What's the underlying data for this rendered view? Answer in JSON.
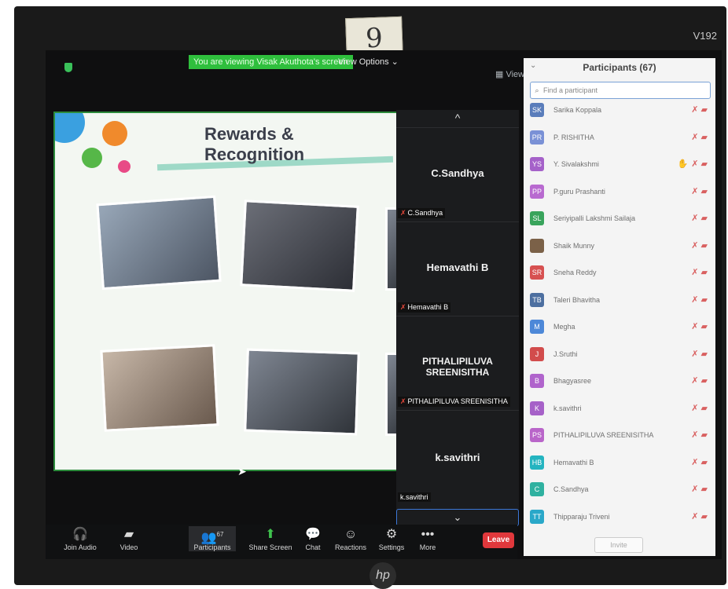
{
  "bezel": {
    "model_label": "V192",
    "sticky_note": "9",
    "brand_logo": "hp"
  },
  "zoom_top": {
    "viewing_banner": "You are viewing Visak Akuthota's screen",
    "view_options": "View Options ⌄",
    "view_button": "View"
  },
  "slide": {
    "title": "Rewards & Recognition"
  },
  "gallery": {
    "up_chevron": "^",
    "down_chevron": "⌄",
    "tiles": [
      {
        "name": "C.Sandhya",
        "label": "C.Sandhya"
      },
      {
        "name": "Hemavathi B",
        "label": "Hemavathi B"
      },
      {
        "name": "PITHALIPILUVA SREENISITHA",
        "label": "PITHALIPILUVA SREENISITHA"
      },
      {
        "name": "k.savithri",
        "label": "k.savithri"
      }
    ]
  },
  "participants_panel": {
    "title": "Participants (67)",
    "search_placeholder": "Find a participant",
    "invite_label": "Invite",
    "participants": [
      {
        "initials": "SK",
        "name": "Sarika Koppala",
        "color": "#5a7dbb",
        "raised_hand": false
      },
      {
        "initials": "PR",
        "name": "P. RISHITHA",
        "color": "#7a91d6",
        "raised_hand": false
      },
      {
        "initials": "YS",
        "name": "Y. Sivalakshmi",
        "color": "#a561c9",
        "raised_hand": true
      },
      {
        "initials": "PP",
        "name": "P.guru Prashanti",
        "color": "#b86ad0",
        "raised_hand": false
      },
      {
        "initials": "SL",
        "name": "Seriyipalli Lakshmi Sailaja",
        "color": "#39a45c",
        "raised_hand": false
      },
      {
        "initials": "",
        "name": "Shaik Munny",
        "color": "#7b6148",
        "raised_hand": false
      },
      {
        "initials": "SR",
        "name": "Sneha Reddy",
        "color": "#d75151",
        "raised_hand": false
      },
      {
        "initials": "TB",
        "name": "Taleri Bhavitha",
        "color": "#4d6fa0",
        "raised_hand": false
      },
      {
        "initials": "M",
        "name": "Megha",
        "color": "#4d88d8",
        "raised_hand": false
      },
      {
        "initials": "J",
        "name": "J.Sruthi",
        "color": "#d24c4c",
        "raised_hand": false
      },
      {
        "initials": "B",
        "name": "Bhagyasree",
        "color": "#b064cc",
        "raised_hand": false
      },
      {
        "initials": "K",
        "name": "k.savithri",
        "color": "#a661c8",
        "raised_hand": false
      },
      {
        "initials": "PS",
        "name": "PITHALIPILUVA SREENISITHA",
        "color": "#b965c9",
        "raised_hand": false
      },
      {
        "initials": "HB",
        "name": "Hemavathi B",
        "color": "#24b4c0",
        "raised_hand": false
      },
      {
        "initials": "C",
        "name": "C.Sandhya",
        "color": "#2fb1a0",
        "raised_hand": false
      },
      {
        "initials": "TT",
        "name": "Thipparaju Triveni",
        "color": "#2aa8c9",
        "raised_hand": false
      }
    ]
  },
  "toolbar": {
    "join_audio": "Join Audio",
    "video": "Video",
    "participants": "Participants",
    "participants_count": "67",
    "share_screen": "Share Screen",
    "chat": "Chat",
    "reactions": "Reactions",
    "settings": "Settings",
    "more": "More",
    "leave": "Leave"
  }
}
